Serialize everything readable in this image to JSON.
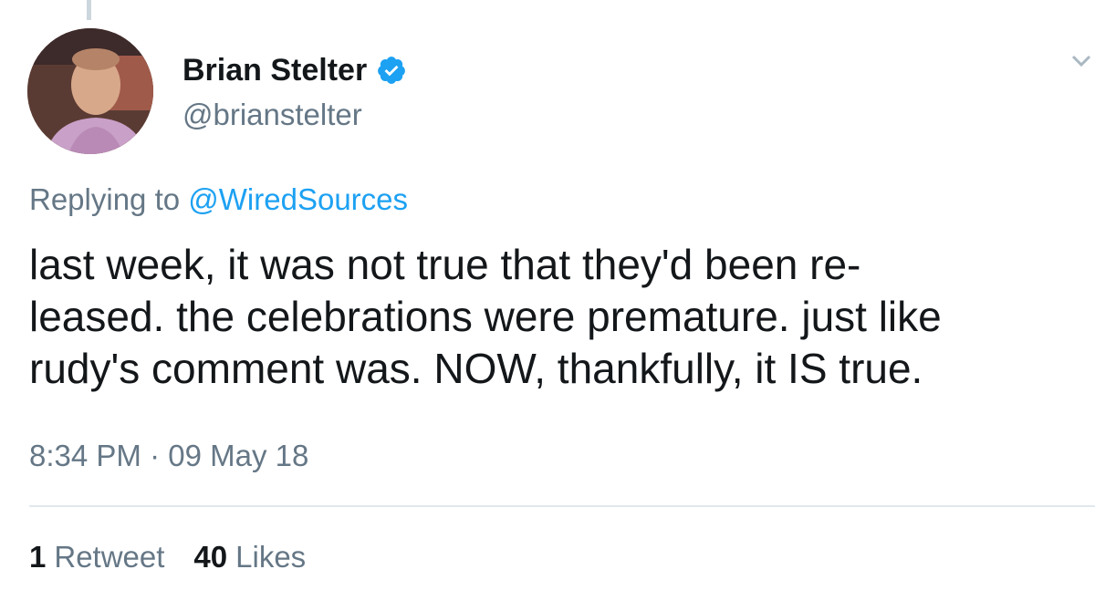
{
  "author": {
    "display_name": "Brian Stelter",
    "handle": "@brianstelter",
    "verified": true,
    "avatar_icon": "profile-photo"
  },
  "reply": {
    "prefix": "Replying to",
    "mention": "@WiredSources"
  },
  "tweet": {
    "lines": [
      "last week, it was not true that they'd been re-",
      "leased. the celebrations were premature. just like",
      "rudy's comment was. NOW, thankfully, it IS true."
    ],
    "timestamp": "8:34 PM · 09 May 18"
  },
  "stats": {
    "retweets_count": "1",
    "retweets_label": "Retweet",
    "likes_count": "40",
    "likes_label": "Likes"
  },
  "colors": {
    "text": "#14171a",
    "secondary": "#657786",
    "accent": "#1da1f2",
    "divider": "#e1e8ed"
  }
}
